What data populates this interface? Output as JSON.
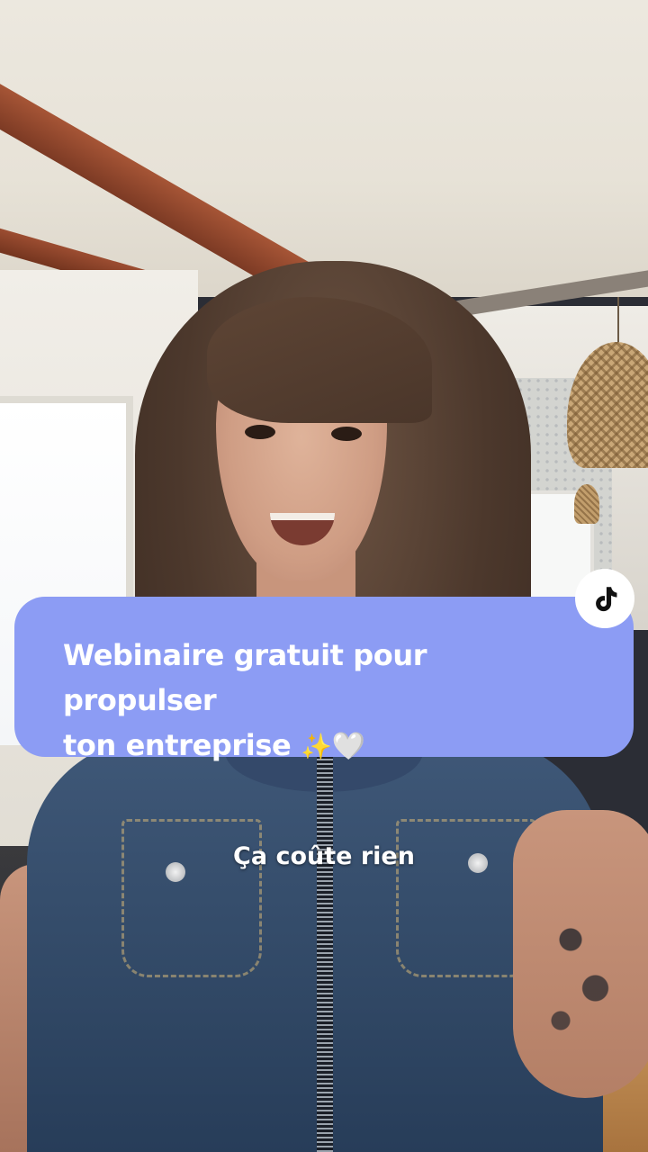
{
  "overlay": {
    "caption": {
      "line1": "Webinaire gratuit pour propulser",
      "line2": "ton entreprise",
      "sparkles": "✨",
      "heart": "🤍",
      "background_color": "#8c9cf4",
      "text_color": "#ffffff"
    },
    "subtitle": "Ça coûte rien",
    "badge_icon": "tiktok-icon"
  }
}
